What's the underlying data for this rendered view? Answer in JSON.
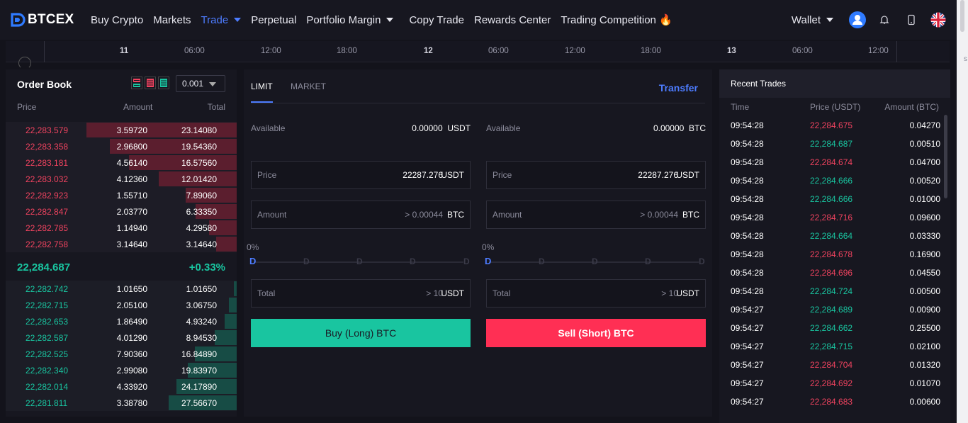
{
  "nav": {
    "logo_text": "BTCEX",
    "items": [
      {
        "label": "Buy Crypto",
        "caret": false,
        "active": false
      },
      {
        "label": "Markets",
        "caret": false,
        "active": false
      },
      {
        "label": "Trade",
        "caret": true,
        "active": true
      },
      {
        "label": "Perpetual",
        "caret": false,
        "active": false
      },
      {
        "label": "Portfolio Margin",
        "caret": true,
        "active": false
      },
      {
        "label": "Copy Trade",
        "caret": false,
        "active": false
      },
      {
        "label": "Rewards Center",
        "caret": false,
        "active": false
      },
      {
        "label": "Trading Competition 🔥",
        "caret": false,
        "active": false
      }
    ],
    "wallet_label": "Wallet",
    "icons": [
      "avatar-icon",
      "bell-icon",
      "mobile-icon",
      "uk-flag-icon"
    ]
  },
  "timeline": {
    "ticks": [
      "11",
      "06:00",
      "12:00",
      "18:00",
      "12",
      "06:00",
      "12:00",
      "18:00",
      "13",
      "06:00",
      "12:00"
    ]
  },
  "orderbook": {
    "title": "Order Book",
    "precision": "0.001",
    "headers": {
      "price": "Price",
      "amount": "Amount",
      "total": "Total"
    },
    "asks": [
      {
        "price": "22,283.579",
        "amount": "3.59720",
        "total": "23.14080"
      },
      {
        "price": "22,283.358",
        "amount": "2.96800",
        "total": "19.54360"
      },
      {
        "price": "22,283.181",
        "amount": "4.56140",
        "total": "16.57560"
      },
      {
        "price": "22,283.032",
        "amount": "4.12360",
        "total": "12.01420"
      },
      {
        "price": "22,282.923",
        "amount": "1.55710",
        "total": "7.89060"
      },
      {
        "price": "22,282.847",
        "amount": "2.03770",
        "total": "6.33350"
      },
      {
        "price": "22,282.785",
        "amount": "1.14940",
        "total": "4.29580"
      },
      {
        "price": "22,282.758",
        "amount": "3.14640",
        "total": "3.14640"
      }
    ],
    "last_price": "22,284.687",
    "change": "+0.33%",
    "bids": [
      {
        "price": "22,282.742",
        "amount": "1.01650",
        "total": "1.01650"
      },
      {
        "price": "22,282.715",
        "amount": "2.05100",
        "total": "3.06750"
      },
      {
        "price": "22,282.653",
        "amount": "1.86490",
        "total": "4.93240"
      },
      {
        "price": "22,282.587",
        "amount": "4.01290",
        "total": "8.94530"
      },
      {
        "price": "22,282.525",
        "amount": "7.90360",
        "total": "16.84890"
      },
      {
        "price": "22,282.340",
        "amount": "2.99080",
        "total": "19.83970"
      },
      {
        "price": "22,282.014",
        "amount": "4.33920",
        "total": "24.17890"
      },
      {
        "price": "22,281.811",
        "amount": "3.38780",
        "total": "27.56670"
      }
    ]
  },
  "trade": {
    "tabs": [
      "LIMIT",
      "MARKET"
    ],
    "transfer_label": "Transfer",
    "buy": {
      "available_label": "Available",
      "available_value": "0.00000",
      "available_unit": "USDT",
      "price_label": "Price",
      "price_value": "22287.276",
      "price_unit": "USDT",
      "amount_label": "Amount",
      "amount_placeholder": "> 0.00044",
      "amount_unit": "BTC",
      "slider_pct": "0%",
      "total_label": "Total",
      "total_placeholder": "> 10",
      "total_unit": "USDT",
      "button_label": "Buy (Long) BTC"
    },
    "sell": {
      "available_label": "Available",
      "available_value": "0.00000",
      "available_unit": "BTC",
      "price_label": "Price",
      "price_value": "22287.276",
      "price_unit": "USDT",
      "amount_label": "Amount",
      "amount_placeholder": "> 0.00044",
      "amount_unit": "BTC",
      "slider_pct": "0%",
      "total_label": "Total",
      "total_placeholder": "> 10",
      "total_unit": "USDT",
      "button_label": "Sell (Short) BTC"
    }
  },
  "recent_trades": {
    "title": "Recent Trades",
    "headers": {
      "time": "Time",
      "price": "Price (USDT)",
      "amount": "Amount (BTC)"
    },
    "rows": [
      {
        "time": "09:54:28",
        "price": "22,284.675",
        "amount": "0.04270",
        "side": "down"
      },
      {
        "time": "09:54:28",
        "price": "22,284.687",
        "amount": "0.00510",
        "side": "up"
      },
      {
        "time": "09:54:28",
        "price": "22,284.674",
        "amount": "0.04700",
        "side": "down"
      },
      {
        "time": "09:54:28",
        "price": "22,284.666",
        "amount": "0.00520",
        "side": "up"
      },
      {
        "time": "09:54:28",
        "price": "22,284.666",
        "amount": "0.01000",
        "side": "up"
      },
      {
        "time": "09:54:28",
        "price": "22,284.716",
        "amount": "0.09600",
        "side": "down"
      },
      {
        "time": "09:54:28",
        "price": "22,284.664",
        "amount": "0.03330",
        "side": "up"
      },
      {
        "time": "09:54:28",
        "price": "22,284.678",
        "amount": "0.16900",
        "side": "down"
      },
      {
        "time": "09:54:28",
        "price": "22,284.696",
        "amount": "0.04550",
        "side": "down"
      },
      {
        "time": "09:54:28",
        "price": "22,284.724",
        "amount": "0.00500",
        "side": "up"
      },
      {
        "time": "09:54:27",
        "price": "22,284.689",
        "amount": "0.00900",
        "side": "up"
      },
      {
        "time": "09:54:27",
        "price": "22,284.662",
        "amount": "0.25500",
        "side": "up"
      },
      {
        "time": "09:54:27",
        "price": "22,284.715",
        "amount": "0.02100",
        "side": "up"
      },
      {
        "time": "09:54:27",
        "price": "22,284.704",
        "amount": "0.01320",
        "side": "down"
      },
      {
        "time": "09:54:27",
        "price": "22,284.692",
        "amount": "0.01070",
        "side": "down"
      },
      {
        "time": "09:54:27",
        "price": "22,284.683",
        "amount": "0.00600",
        "side": "down"
      }
    ]
  },
  "colors": {
    "accent": "#4d7cff",
    "buy": "#19c5a0",
    "sell": "#ff2f54",
    "ask_text": "#f0435f",
    "background": "#13131b",
    "panel": "#171720"
  }
}
